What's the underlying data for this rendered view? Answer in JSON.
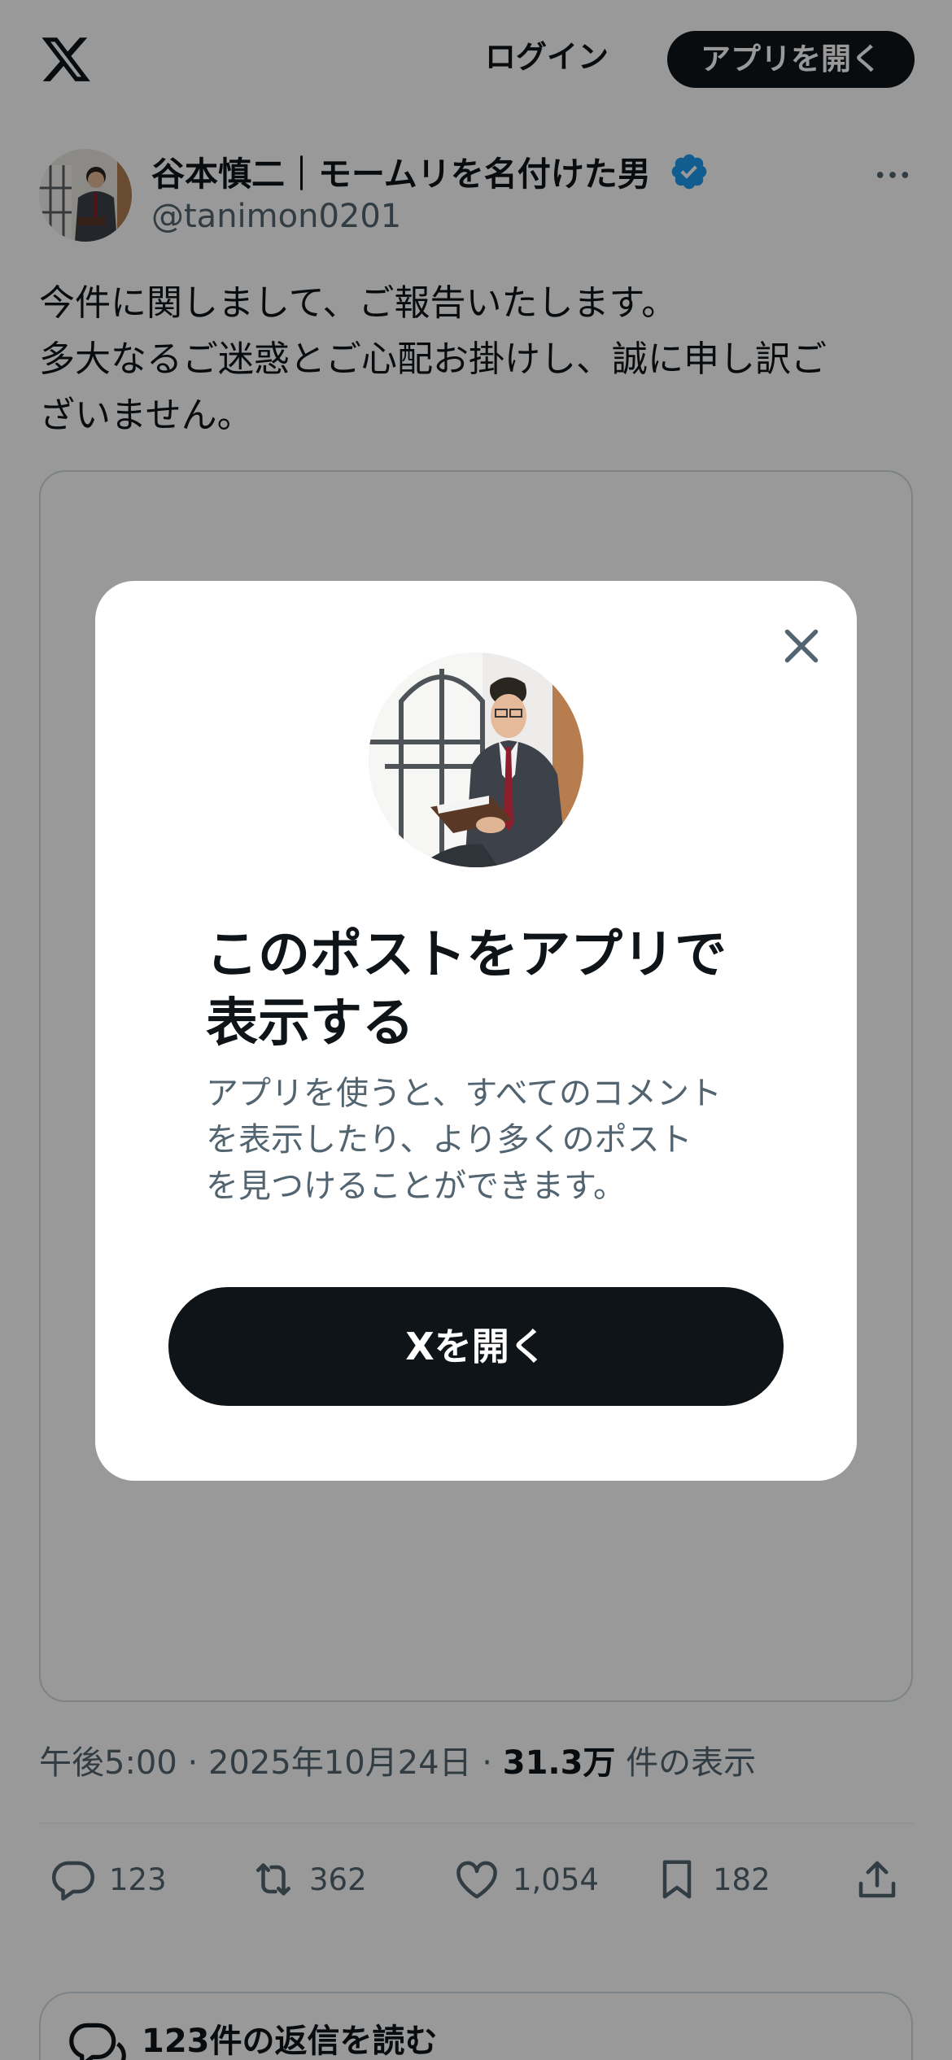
{
  "topbar": {
    "logo_icon": "x-logo-icon",
    "login_label": "ログイン",
    "open_app_label": "アプリを開く"
  },
  "post": {
    "author": {
      "name": "谷本慎二｜モームリを名付けた男",
      "handle": "@tanimon0201",
      "verified": true,
      "verified_color": "#1d9bf0"
    },
    "text_lines": [
      "今件に関しまして、ご報告いたします。",
      "多大なるご迷惑とご心配お掛けし、誠に申し訳ご",
      "ざいません。"
    ],
    "meta": {
      "time": "午後5:00",
      "separator": "·",
      "date": "2025年10月24日",
      "views_count": "31.3万",
      "views_label": "件の表示"
    },
    "actions": {
      "replies": "123",
      "reposts": "362",
      "likes": "1,054",
      "bookmarks": "182"
    },
    "read_replies_label": "123件の返信を読む"
  },
  "modal": {
    "title_lines": [
      "このポストをアプリで",
      "表示する"
    ],
    "desc_lines": [
      "アプリを使うと、すべてのコメント",
      "を表示したり、より多くのポスト",
      "を見つけることができます。"
    ],
    "cta_label": "Xを開く"
  },
  "colors": {
    "text_primary": "#0f1419",
    "text_secondary": "#536471",
    "border": "#cfd9de",
    "overlay": "rgba(0,0,0,0.40)"
  }
}
